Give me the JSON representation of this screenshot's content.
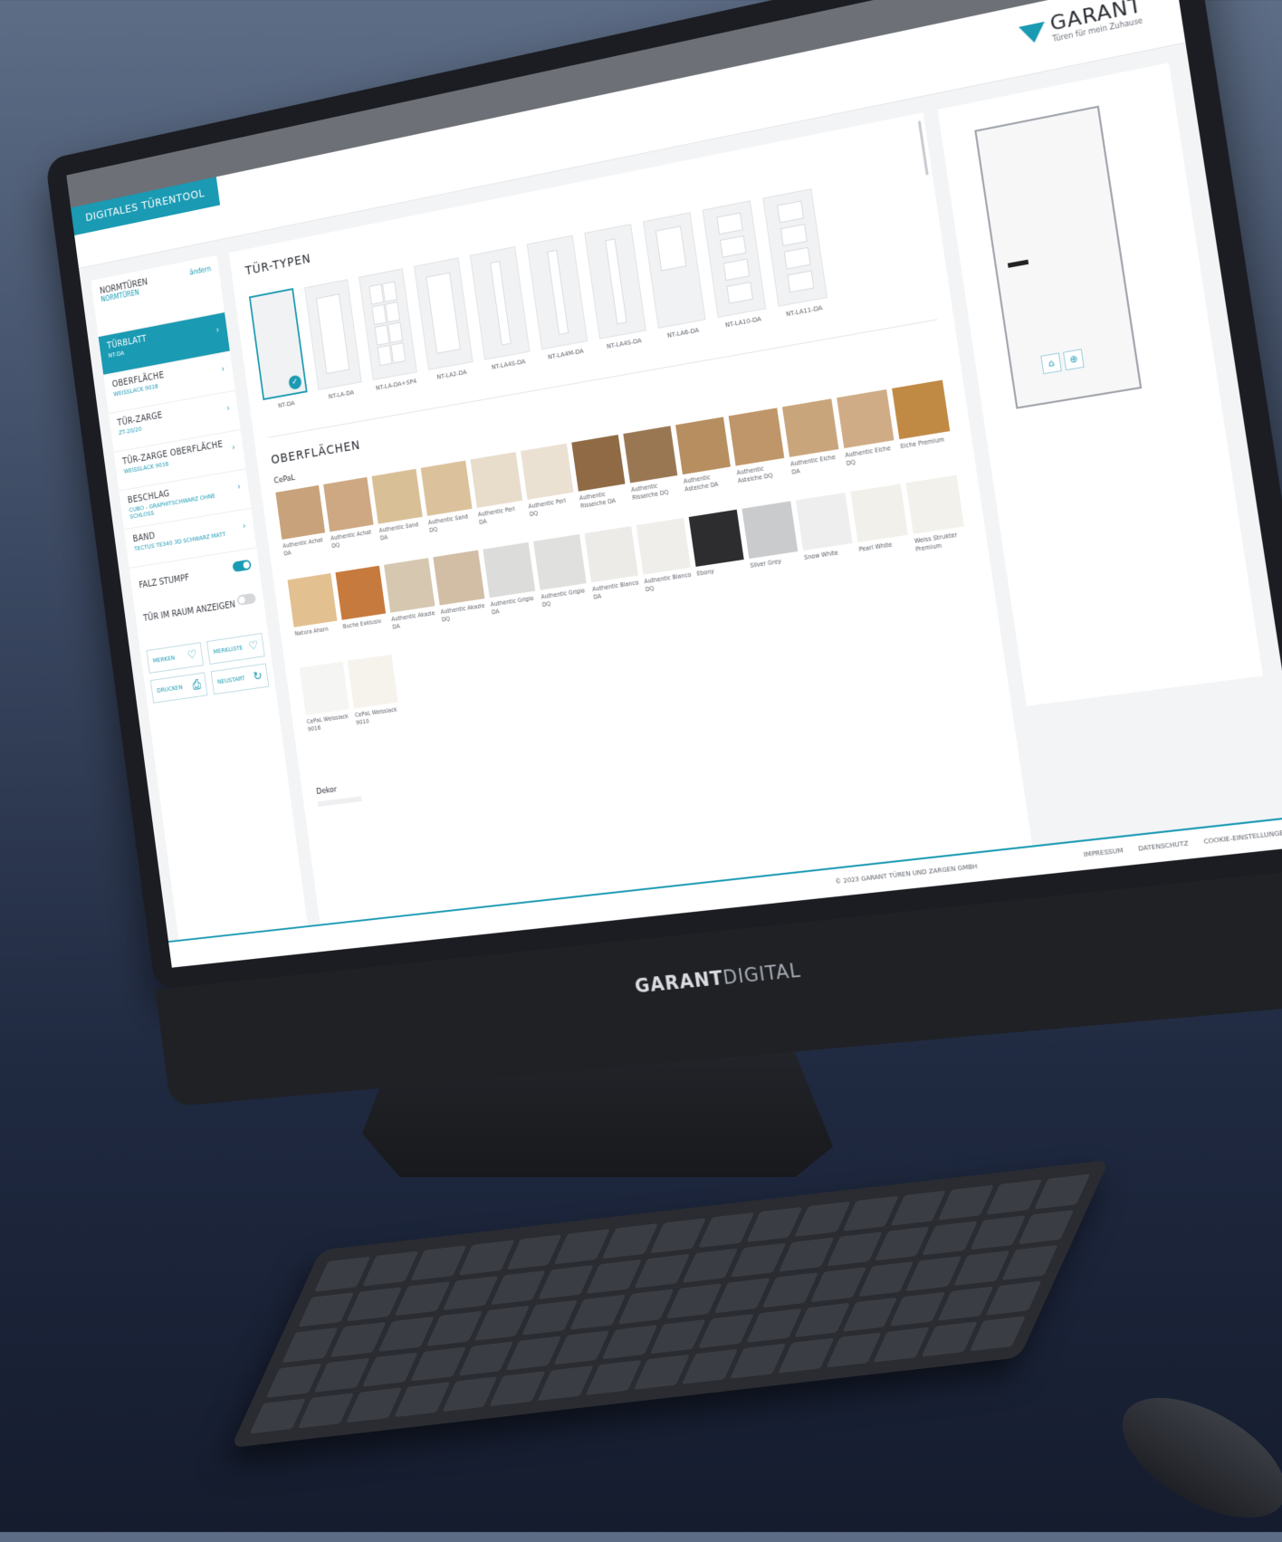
{
  "app": {
    "tool_tab": "DIGITALES TÜRENTOOL",
    "logo_name": "GARANT",
    "logo_tagline": "Türen für mein Zuhause",
    "hardware_brand_bold": "GARANT",
    "hardware_brand_light": "DIGITAL"
  },
  "sidebar": {
    "norm": {
      "title": "NORMTÜREN",
      "value": "NORMTÜREN",
      "edit": "ändern"
    },
    "items": [
      {
        "title": "TÜRBLATT",
        "value": "NT-DA",
        "active": true
      },
      {
        "title": "OBERFLÄCHE",
        "value": "WEISSLACK 9016"
      },
      {
        "title": "TÜR-ZARGE",
        "value": "ZT-20/20"
      },
      {
        "title": "TÜR-ZARGE OBERFLÄCHE",
        "value": "WEISSLACK 9016"
      },
      {
        "title": "BESCHLAG",
        "value": "CUBO - GRAPHITSCHWARZ OHNE SCHLOSS"
      },
      {
        "title": "BAND",
        "value": "TECTUS TE340 3D SCHWARZ MATT"
      }
    ],
    "toggles": [
      {
        "label": "FALZ STUMPF",
        "on": true
      },
      {
        "label": "TÜR IM RAUM ANZEIGEN",
        "on": false
      }
    ],
    "buttons": [
      {
        "label": "MERKEN",
        "icon": "heart-icon",
        "glyph": "♡"
      },
      {
        "label": "MERKLISTE",
        "icon": "heart-list-icon",
        "glyph": "♡"
      },
      {
        "label": "DRUCKEN",
        "icon": "printer-icon",
        "glyph": "⎙"
      },
      {
        "label": "NEUSTART",
        "icon": "refresh-icon",
        "glyph": "↻"
      }
    ]
  },
  "main": {
    "types_title": "TÜR-TYPEN",
    "types": [
      {
        "label": "NT-DA",
        "selected": true,
        "pattern": "none"
      },
      {
        "label": "NT-LA-DA",
        "pattern": "big"
      },
      {
        "label": "NT-LA-DA+SP4",
        "pattern": "grid"
      },
      {
        "label": "NT-LA2-DA",
        "pattern": "big"
      },
      {
        "label": "NT-LA4S-DA",
        "pattern": "slim"
      },
      {
        "label": "NT-LA4M-DA",
        "pattern": "slim"
      },
      {
        "label": "NT-LA4S-DA",
        "pattern": "slim"
      },
      {
        "label": "NT-LA6-DA",
        "pattern": "top"
      },
      {
        "label": "NT-LA10-DA",
        "pattern": "stack"
      },
      {
        "label": "NT-LA11-DA",
        "pattern": "stack"
      }
    ],
    "surfaces_title": "OBERFLÄCHEN",
    "cepal_title": "CePaL",
    "swatches": [
      {
        "name": "Authentic Achat DA",
        "color": "#c8a27a"
      },
      {
        "name": "Authentic Achat DQ",
        "color": "#cda883"
      },
      {
        "name": "Authentic Sand DA",
        "color": "#d9bf96"
      },
      {
        "name": "Authentic Sand DQ",
        "color": "#dcc29c"
      },
      {
        "name": "Authentic Perl DA",
        "color": "#e8dccb"
      },
      {
        "name": "Authentic Perl DQ",
        "color": "#ebe1d2"
      },
      {
        "name": "Authentic Risseiche DA",
        "color": "#8f6a44"
      },
      {
        "name": "Authentic Risseiche DQ",
        "color": "#9a7753"
      },
      {
        "name": "Authentic Asteiche DA",
        "color": "#b78e5f"
      },
      {
        "name": "Authentic Asteiche DQ",
        "color": "#bf9669"
      },
      {
        "name": "Authentic Eiche DA",
        "color": "#c9a57c"
      },
      {
        "name": "Authentic Eiche DQ",
        "color": "#cfac86"
      },
      {
        "name": "Eiche Premium",
        "color": "#c08a44"
      },
      {
        "name": "Natura Ahorn",
        "color": "#e2c08f"
      },
      {
        "name": "Buche Exklusiv",
        "color": "#c77a3d"
      },
      {
        "name": "Authentic Akazie DA",
        "color": "#d6c7b1"
      },
      {
        "name": "Authentic Akazie DQ",
        "color": "#d2bda5"
      },
      {
        "name": "Authentic Grigio DA",
        "color": "#dcdcda"
      },
      {
        "name": "Authentic Grigio DQ",
        "color": "#e0e0de"
      },
      {
        "name": "Authentic Bianco DA",
        "color": "#ecebe7"
      },
      {
        "name": "Authentic Bianco DQ",
        "color": "#efeeea"
      },
      {
        "name": "Ebony",
        "color": "#2d2d2f"
      },
      {
        "name": "Silver Grey",
        "color": "#c9cbcc"
      },
      {
        "name": "Snow White",
        "color": "#eeeeee"
      },
      {
        "name": "Pearl White",
        "color": "#f1f0ea"
      },
      {
        "name": "Weiss Strukter Premium",
        "color": "#f2f1ec"
      },
      {
        "name": "CePaL Weisslack 9016",
        "color": "#f5f5f3"
      },
      {
        "name": "CePaL Weisslack 9010",
        "color": "#f5f3ec"
      }
    ],
    "dekor_title": "Dekor"
  },
  "footer": {
    "copyright": "© 2023 GARANT TÜREN UND ZARGEN GMBH",
    "links": [
      "IMPRESSUM",
      "DATENSCHUTZ",
      "COOKIE-EINSTELLUNGEN"
    ]
  },
  "colors": {
    "accent": "#1a9ab3",
    "background": "#2a3550"
  }
}
